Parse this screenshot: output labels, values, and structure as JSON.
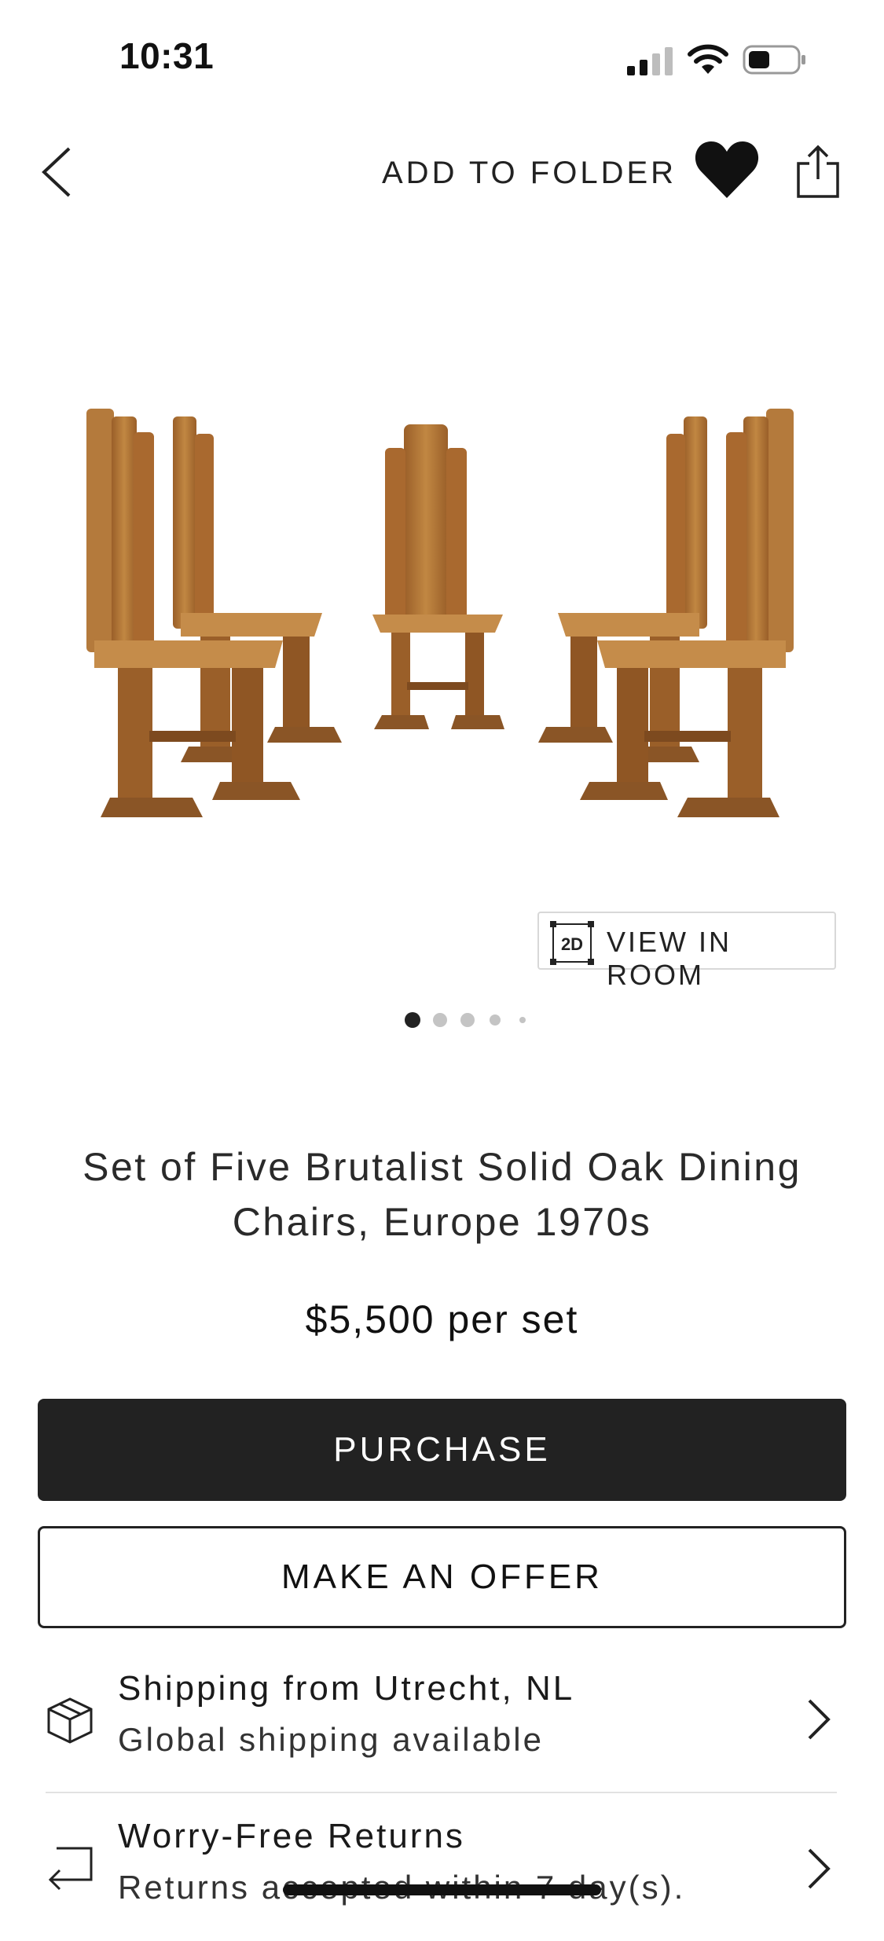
{
  "status_bar": {
    "time": "10:31"
  },
  "nav": {
    "add_to_folder": "ADD TO FOLDER"
  },
  "gallery": {
    "view_in_room": "VIEW IN ROOM",
    "view_in_room_badge": "2D",
    "image_count": 5,
    "active_image": 1
  },
  "product": {
    "title": "Set of Five Brutalist Solid Oak Dining Chairs, Europe 1970s",
    "price": "$5,500 per set"
  },
  "actions": {
    "purchase": "PURCHASE",
    "make_offer": "MAKE AN OFFER"
  },
  "info_rows": [
    {
      "title": "Shipping from Utrecht, NL",
      "subtitle": "Global shipping available",
      "icon": "package-icon"
    },
    {
      "title": "Worry-Free Returns",
      "subtitle": "Returns accepted within 7 day(s).",
      "icon": "return-arrow-icon"
    }
  ],
  "colors": {
    "primary": "#222222",
    "wood": "#b67b3d",
    "wood_dark": "#8a5526"
  }
}
